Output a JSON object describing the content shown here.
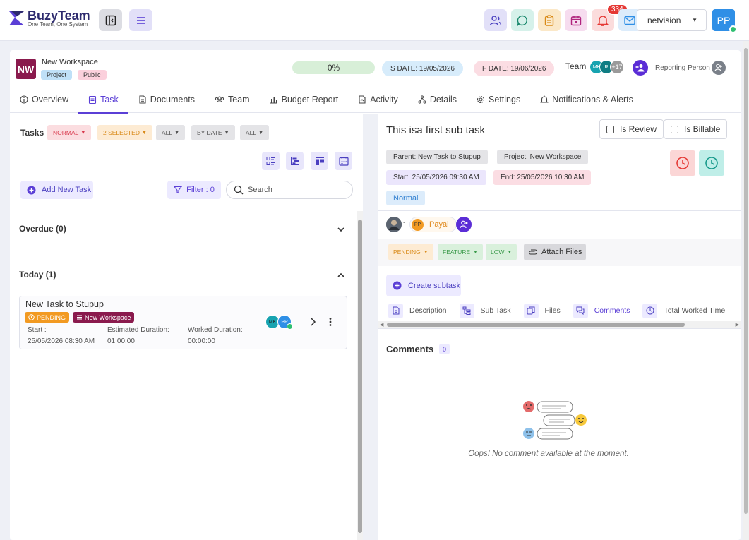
{
  "brand": {
    "name": "BuzyTeam",
    "tagline": "One Team, One System"
  },
  "topbar": {
    "notification_count": "334",
    "org_selected": "netvision",
    "user_initials": "PP"
  },
  "workspace": {
    "logo_initials": "NW",
    "name": "New Workspace",
    "tag_project": "Project",
    "tag_public": "Public",
    "progress": "0%",
    "start_date": "S DATE: 19/05/2026",
    "finish_date": "F DATE: 19/06/2026",
    "team_label": "Team",
    "team_members": [
      "MK",
      "R",
      "+17"
    ],
    "reporting_label": "Reporting Person"
  },
  "tabs": [
    "Overview",
    "Task",
    "Documents",
    "Team",
    "Budget Report",
    "Activity",
    "Details",
    "Settings",
    "Notifications & Alerts"
  ],
  "tasks_panel": {
    "title": "Tasks",
    "filters": [
      "NORMAL",
      "2 SELECTED",
      "ALL",
      "BY DATE",
      "ALL"
    ],
    "add_task": "Add New Task",
    "filter_label": "Filter : 0",
    "search_placeholder": "Search",
    "overdue": "Overdue (0)",
    "today": "Today (1)",
    "task": {
      "title": "New Task to Stupup",
      "status": "PENDING",
      "workspace": "New Workspace",
      "start_label": "Start :",
      "start_value": "25/05/2026 08:30 AM",
      "est_label": "Estimated Duration:",
      "est_value": "01:00:00",
      "worked_label": "Worked Duration:",
      "worked_value": "00:00:00",
      "assignees": [
        "MK",
        "PP"
      ]
    }
  },
  "detail": {
    "title": "This isa first sub task",
    "is_review": "Is Review",
    "is_billable": "Is Billable",
    "parent": "Parent:  New Task to Stupup",
    "project": "Project:  New Workspace",
    "start": "Start:  25/05/2026 09:30 AM",
    "end": "End:  25/05/2026 10:30 AM",
    "priority_tag": "Normal",
    "assignee_sep": "-",
    "assignee_initials": "PP",
    "assignee_name": "Payal",
    "status": "PENDING",
    "type": "FEATURE",
    "priority": "LOW",
    "attach": "Attach Files",
    "create_subtask": "Create subtask",
    "subtabs": [
      "Description",
      "Sub Task",
      "Files",
      "Comments",
      "Total Worked Time"
    ],
    "comments_title": "Comments",
    "comments_count": "0",
    "empty_msg": "Oops! No comment available at the moment."
  }
}
